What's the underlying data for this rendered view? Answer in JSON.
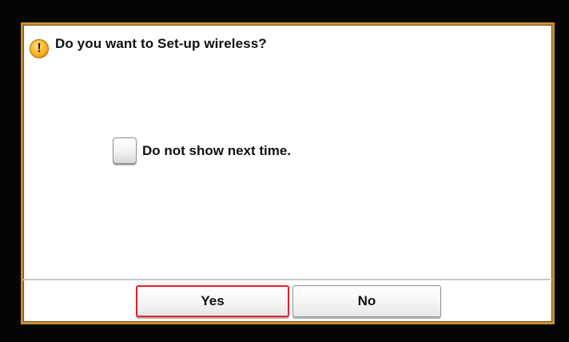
{
  "dialog": {
    "icon": "warning-icon",
    "icon_glyph": "!",
    "title": "Do you want to Set-up wireless?"
  },
  "option": {
    "label": "Do not show next time.",
    "checked": false
  },
  "buttons": {
    "yes_label": "Yes",
    "no_label": "No"
  },
  "colors": {
    "frame": "#c8902f",
    "selection": "#e61e2b",
    "background": "#050505"
  }
}
